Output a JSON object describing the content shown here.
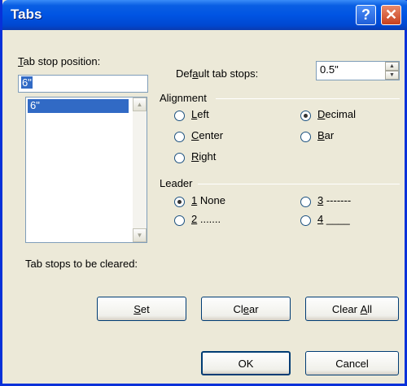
{
  "window": {
    "title": "Tabs",
    "help_label": "?",
    "close_label": "✕"
  },
  "tab_stop": {
    "label_prefix": "",
    "label_accel": "T",
    "label_rest": "ab stop position:",
    "value": "6\"",
    "list_items": [
      "6\""
    ]
  },
  "default_tabs": {
    "label_prefix": "Def",
    "label_accel": "a",
    "label_rest": "ult tab stops:",
    "value": "0.5\""
  },
  "alignment": {
    "group_label": "Alignment",
    "options": [
      {
        "accel": "L",
        "rest": "eft",
        "checked": false
      },
      {
        "accel": "C",
        "rest": "enter",
        "checked": false
      },
      {
        "accel": "R",
        "rest": "ight",
        "checked": false
      },
      {
        "accel": "D",
        "rest": "ecimal",
        "checked": true
      },
      {
        "accel": "B",
        "rest": "ar",
        "checked": false
      }
    ]
  },
  "leader": {
    "group_label": "Leader",
    "options": [
      {
        "accel": "1",
        "rest": " None",
        "checked": true
      },
      {
        "accel": "2",
        "rest": " .......",
        "checked": false
      },
      {
        "accel": "3",
        "rest": " -------",
        "checked": false
      },
      {
        "accel": "4",
        "rest": " ____",
        "checked": false
      }
    ]
  },
  "cleared": {
    "label": "Tab stops to be cleared:"
  },
  "buttons": {
    "set": {
      "accel": "S",
      "rest": "et"
    },
    "clear": {
      "prefix": "Cl",
      "accel": "e",
      "rest": "ar"
    },
    "clear_all": {
      "prefix": "Clear ",
      "accel": "A",
      "rest": "ll"
    },
    "ok": "OK",
    "cancel": "Cancel"
  }
}
